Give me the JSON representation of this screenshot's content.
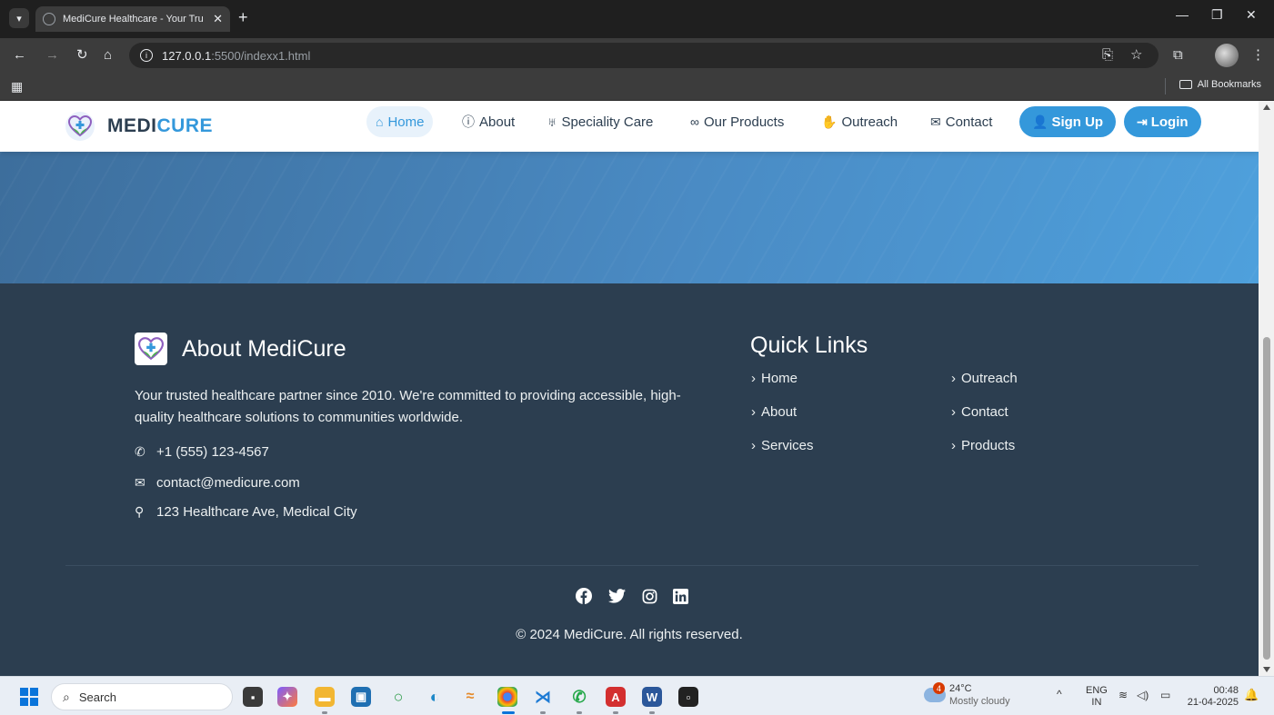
{
  "browser": {
    "tab_title": "MediCure Healthcare - Your Tru",
    "url_host": "127.0.0.1",
    "url_rest": ":5500/indexx1.html",
    "all_bookmarks": "All Bookmarks"
  },
  "nav": {
    "brand_part1": "MEDI",
    "brand_part2": "CURE",
    "items": [
      {
        "label": "Home",
        "icon": "home-icon"
      },
      {
        "label": "About",
        "icon": "info-circle-icon"
      },
      {
        "label": "Speciality Care",
        "icon": "stethoscope-icon"
      },
      {
        "label": "Our Products",
        "icon": "binoculars-icon"
      },
      {
        "label": "Outreach",
        "icon": "hand-holding-icon"
      },
      {
        "label": "Contact",
        "icon": "envelope-icon"
      }
    ],
    "signup": "Sign Up",
    "login": "Login"
  },
  "footer": {
    "about_title": "About MediCure",
    "about_text": "Your trusted healthcare partner since 2010. We're committed to providing accessible, high-quality healthcare solutions to communities worldwide.",
    "phone": "+1 (555) 123-4567",
    "email": "contact@medicure.com",
    "address": "123 Healthcare Ave, Medical City",
    "quick_links_title": "Quick Links",
    "quick_links": [
      "Home",
      "About",
      "Services",
      "Outreach",
      "Contact",
      "Products"
    ],
    "social": [
      "facebook-icon",
      "twitter-icon",
      "instagram-icon",
      "linkedin-icon"
    ],
    "copyright": "© 2024 MediCure. All rights reserved."
  },
  "taskbar": {
    "search_placeholder": "Search",
    "weather_temp": "24°C",
    "weather_desc": "Mostly cloudy",
    "weather_badge": "4",
    "lang_top": "ENG",
    "lang_bottom": "IN",
    "time": "00:48",
    "date": "21-04-2025"
  },
  "colors": {
    "accent": "#3498db",
    "footer_bg": "#2c3e50",
    "brand_dark": "#2c3e50"
  }
}
